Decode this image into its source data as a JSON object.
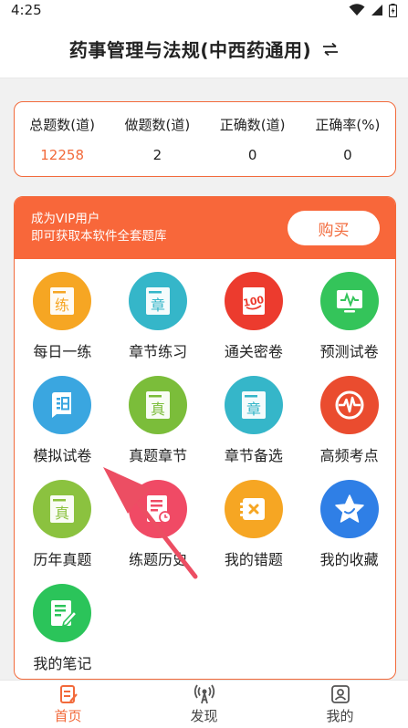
{
  "status_bar": {
    "time": "4:25"
  },
  "header": {
    "title": "药事管理与法规(中西药通用)"
  },
  "stats": {
    "columns": [
      {
        "label": "总题数(道)",
        "value": "12258"
      },
      {
        "label": "做题数(道)",
        "value": "2"
      },
      {
        "label": "正确数(道)",
        "value": "0"
      },
      {
        "label": "正确率(%)",
        "value": "0"
      }
    ]
  },
  "vip": {
    "line1": "成为VIP用户",
    "line2": "即可获取本软件全套题库",
    "buy_label": "购买"
  },
  "grid": {
    "items": [
      {
        "label": "每日一练",
        "icon": "practice-icon",
        "color": "#f6a623",
        "glyph": "练"
      },
      {
        "label": "章节练习",
        "icon": "chapter-icon",
        "color": "#35b6c9",
        "glyph": "章"
      },
      {
        "label": "通关密卷",
        "icon": "score-100-icon",
        "color": "#ec3b2e",
        "glyph": "100"
      },
      {
        "label": "预测试卷",
        "icon": "monitor-icon",
        "color": "#34c45a",
        "glyph": ""
      },
      {
        "label": "模拟试卷",
        "icon": "document-icon",
        "color": "#3aa6e0",
        "glyph": ""
      },
      {
        "label": "真题章节",
        "icon": "real-exam-icon",
        "color": "#7bbd3a",
        "glyph": "真"
      },
      {
        "label": "章节备选",
        "icon": "chapter-alt-icon",
        "color": "#35b6c9",
        "glyph": "章"
      },
      {
        "label": "高频考点",
        "icon": "heartbeat-icon",
        "color": "#ea4c2f",
        "glyph": ""
      },
      {
        "label": "历年真题",
        "icon": "past-exam-icon",
        "color": "#8bc23f",
        "glyph": "真"
      },
      {
        "label": "练题历史",
        "icon": "history-icon",
        "color": "#f04a65",
        "glyph": ""
      },
      {
        "label": "我的错题",
        "icon": "wrong-answer-icon",
        "color": "#f6a623",
        "glyph": ""
      },
      {
        "label": "我的收藏",
        "icon": "star-icon",
        "color": "#2f7fe6",
        "glyph": ""
      },
      {
        "label": "我的笔记",
        "icon": "notes-icon",
        "color": "#2bc45a",
        "glyph": ""
      }
    ]
  },
  "bottom_nav": {
    "home": "首页",
    "discover": "发现",
    "mine": "我的"
  },
  "colors": {
    "accent": "#f26a3b"
  }
}
